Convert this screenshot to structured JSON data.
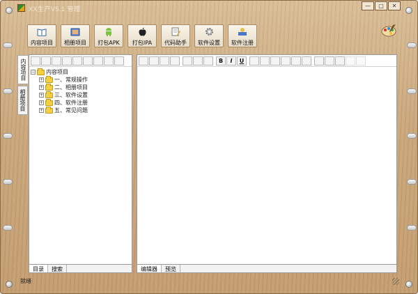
{
  "window": {
    "title": "XX生产V5.1 管理",
    "controls": [
      "—",
      "□",
      "✕"
    ]
  },
  "toolbar": {
    "buttons": [
      {
        "label": "内容项目",
        "icon": "book-icon"
      },
      {
        "label": "相册项目",
        "icon": "photo-album-icon"
      },
      {
        "label": "打包APK",
        "icon": "android-icon"
      },
      {
        "label": "打包IPA",
        "icon": "apple-icon"
      },
      {
        "label": "代码助手",
        "icon": "code-assistant-icon"
      },
      {
        "label": "软件设置",
        "icon": "gear-icon"
      },
      {
        "label": "软件注册",
        "icon": "register-icon"
      }
    ]
  },
  "side_tabs": [
    "内容项目",
    "相册项目"
  ],
  "tree": {
    "root": "内容项目",
    "children": [
      "一、常规操作",
      "二、相册项目",
      "三、软件设置",
      "四、软件注册",
      "五、常见问题"
    ]
  },
  "left_bottom_tabs": [
    "目录",
    "搜索"
  ],
  "editor_tabs": [
    "编辑器",
    "预览"
  ],
  "editor_format_buttons": [
    "B",
    "I",
    "U"
  ],
  "status": {
    "text": "就绪"
  },
  "colors": {
    "accent_wood": "#caa67a",
    "folder": "#f2cf43"
  }
}
